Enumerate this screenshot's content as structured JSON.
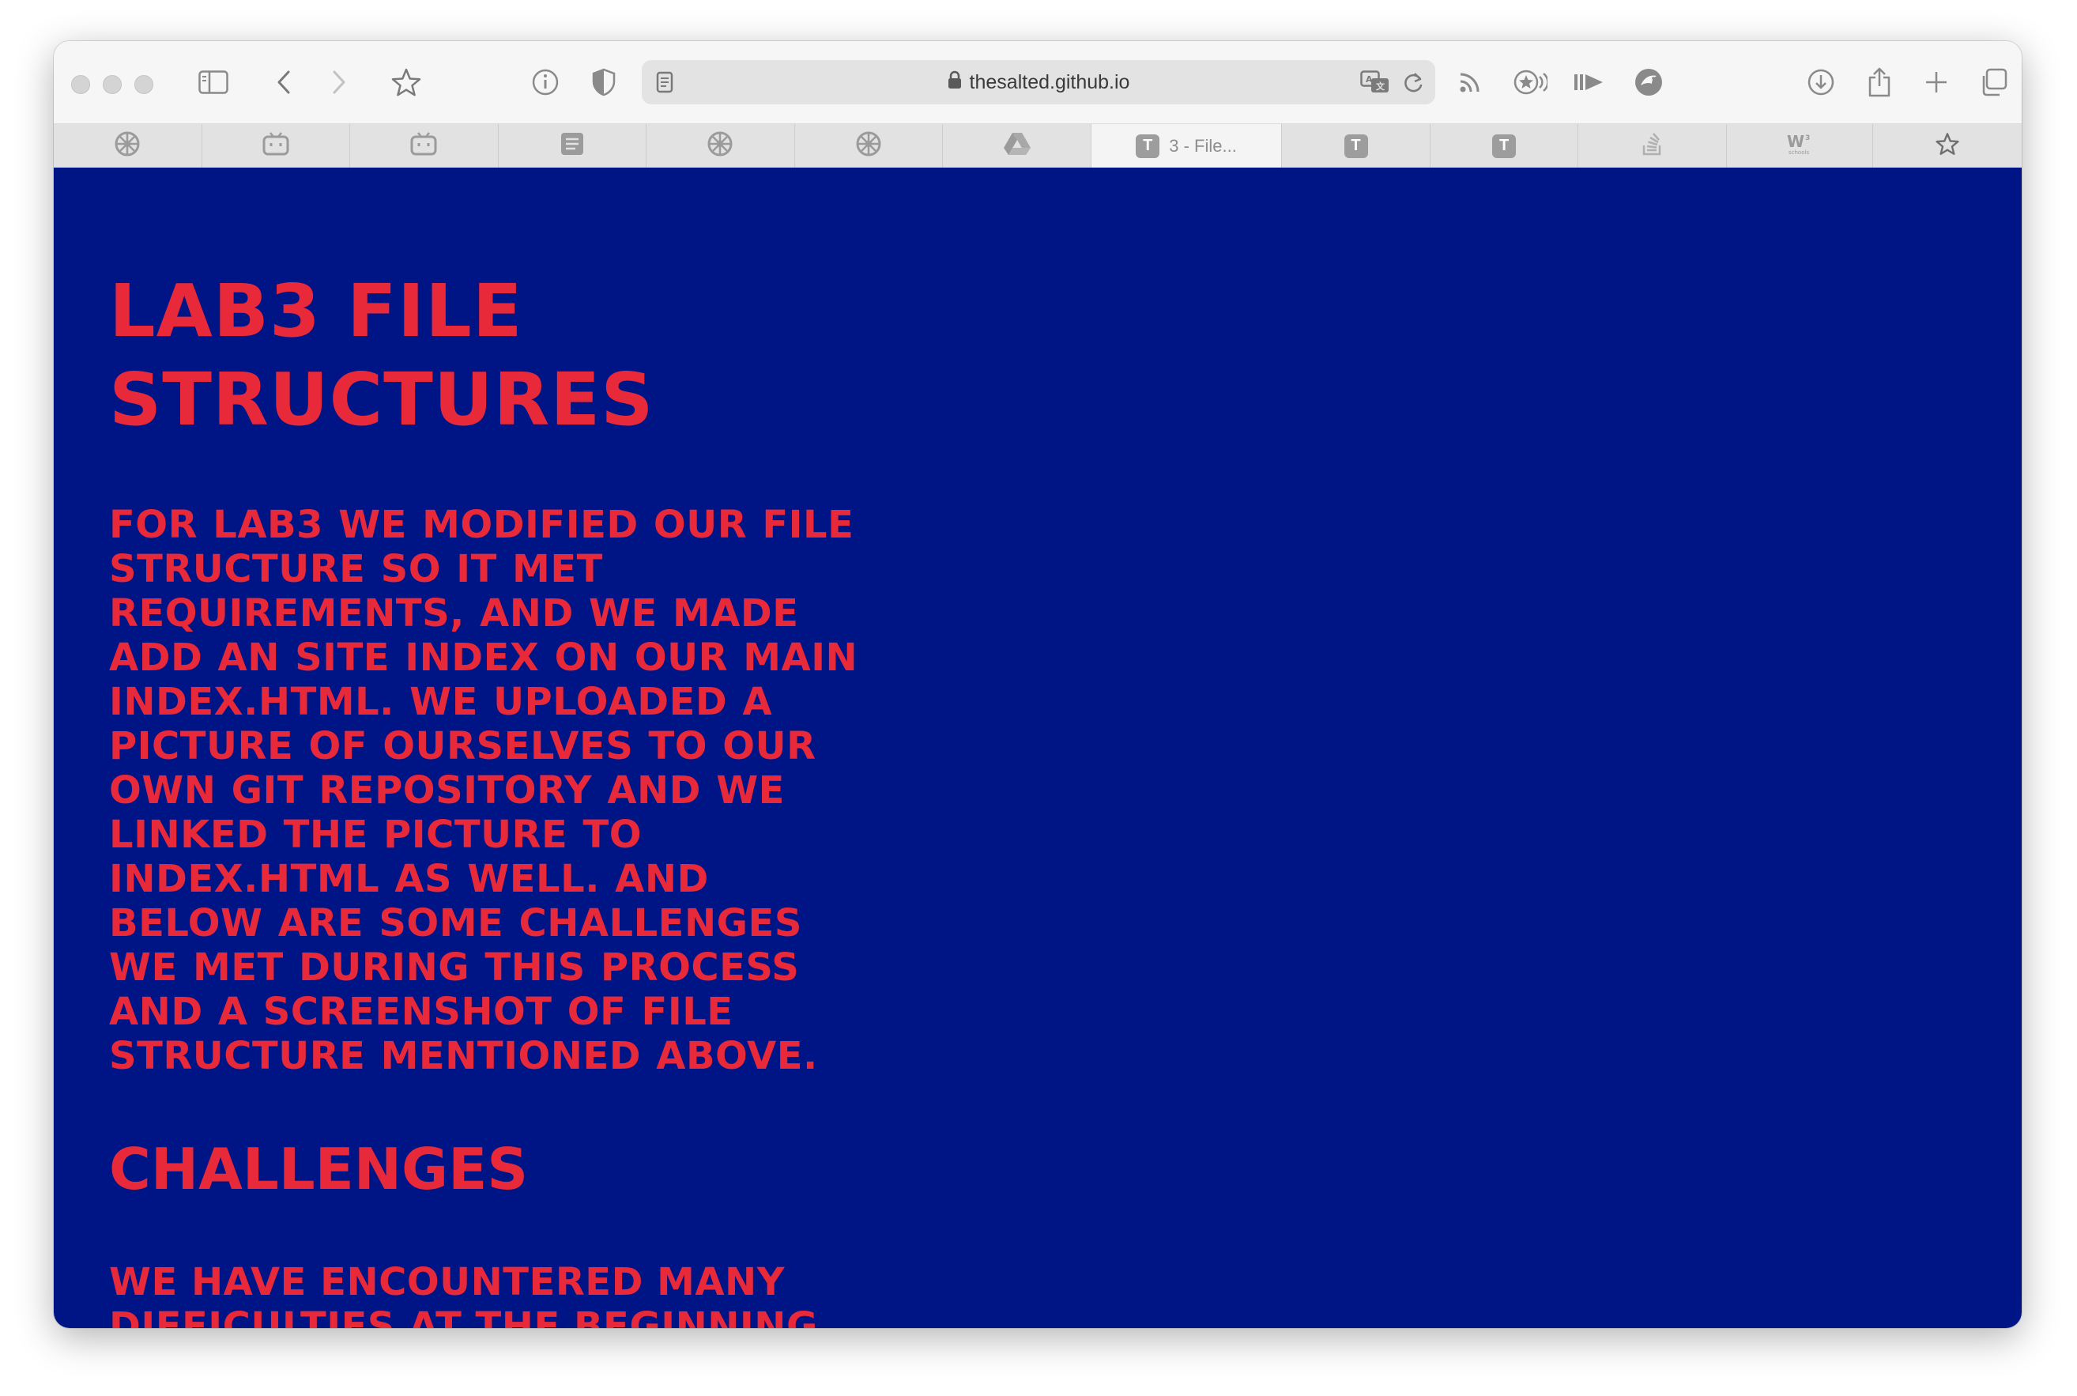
{
  "browser": {
    "url": "thesalted.github.io",
    "tabs": [
      {
        "icon": "gear-wheel-icon",
        "label": ""
      },
      {
        "icon": "bilibili-tv-icon",
        "label": ""
      },
      {
        "icon": "bilibili-tv-icon",
        "label": ""
      },
      {
        "icon": "document-lines-icon",
        "label": ""
      },
      {
        "icon": "gear-wheel-icon",
        "label": ""
      },
      {
        "icon": "gear-wheel-icon",
        "label": ""
      },
      {
        "icon": "google-drive-icon",
        "label": ""
      },
      {
        "icon": "t-badge-icon",
        "badge": "T",
        "label": "3 - File..."
      },
      {
        "icon": "t-badge-icon",
        "badge": "T",
        "label": ""
      },
      {
        "icon": "t-badge-icon",
        "badge": "T",
        "label": ""
      },
      {
        "icon": "stack-overflow-icon",
        "label": ""
      },
      {
        "icon": "w3schools-icon",
        "label": ""
      },
      {
        "icon": "bookmark-star-icon",
        "label": ""
      }
    ]
  },
  "page": {
    "title": "LAB3 FILE STRUCTURES",
    "intro": "FOR LAB3 WE MODIFIED OUR FILE STRUCTURE SO IT MET REQUIREMENTS, AND WE MADE ADD AN SITE INDEX ON OUR MAIN INDEX.HTML. WE UPLOADED A PICTURE OF OURSELVES TO OUR OWN GIT REPOSITORY AND WE LINKED THE PICTURE TO INDEX.HTML AS WELL. AND BELOW ARE SOME CHALLENGES WE MET DURING THIS PROCESS AND A SCREENSHOT OF FILE STRUCTURE MENTIONED ABOVE.",
    "challenges_heading": "CHALLENGES",
    "challenges_text": "WE HAVE ENCOUNTERED MANY DIFFICULTIES AT THE BEGINNING"
  },
  "colors": {
    "page_background": "#001585",
    "text_accent": "#e8293a",
    "toolbar_background": "#f6f6f6",
    "tabbar_background": "#e2e2e2"
  }
}
